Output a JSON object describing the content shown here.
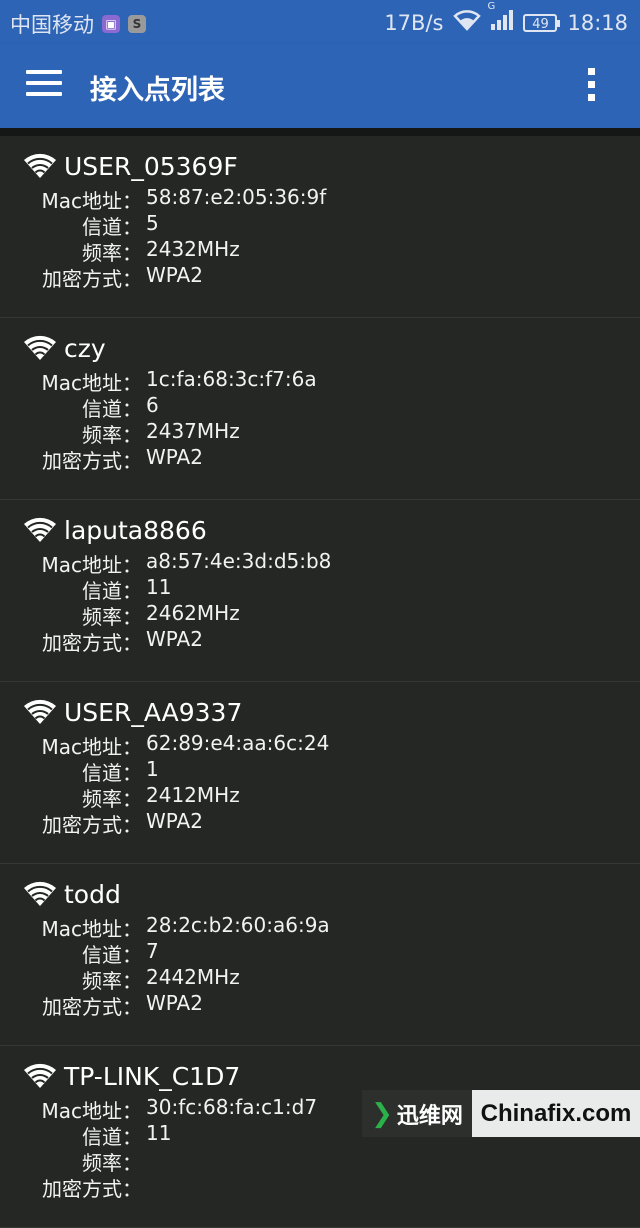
{
  "status_bar": {
    "carrier": "中国移动",
    "speed": "17B/s",
    "network_type": "G",
    "battery": "49",
    "time": "18:18"
  },
  "app_bar": {
    "title": "接入点列表",
    "menu_icon": "hamburger-menu-icon",
    "overflow_icon": "overflow-menu-icon"
  },
  "labels": {
    "mac": "Mac地址：",
    "channel": "信道：",
    "frequency": "频率：",
    "encryption": "加密方式："
  },
  "access_points": [
    {
      "ssid": "USER_05369F",
      "mac": "58:87:e2:05:36:9f",
      "channel": "5",
      "frequency": "2432MHz",
      "encryption": "WPA2"
    },
    {
      "ssid": "czy",
      "mac": "1c:fa:68:3c:f7:6a",
      "channel": "6",
      "frequency": "2437MHz",
      "encryption": "WPA2"
    },
    {
      "ssid": "laputa8866",
      "mac": "a8:57:4e:3d:d5:b8",
      "channel": "11",
      "frequency": "2462MHz",
      "encryption": "WPA2"
    },
    {
      "ssid": "USER_AA9337",
      "mac": "62:89:e4:aa:6c:24",
      "channel": "1",
      "frequency": "2412MHz",
      "encryption": "WPA2"
    },
    {
      "ssid": "todd",
      "mac": "28:2c:b2:60:a6:9a",
      "channel": "7",
      "frequency": "2442MHz",
      "encryption": "WPA2"
    },
    {
      "ssid": "TP-LINK_C1D7",
      "mac": "30:fc:68:fa:c1:d7",
      "channel": "11",
      "frequency": "",
      "encryption": ""
    }
  ],
  "watermark": {
    "left_text": "迅维网",
    "right_text": "Chinafix.com"
  },
  "colors": {
    "primary": "#2e64b6",
    "background": "#242723"
  }
}
